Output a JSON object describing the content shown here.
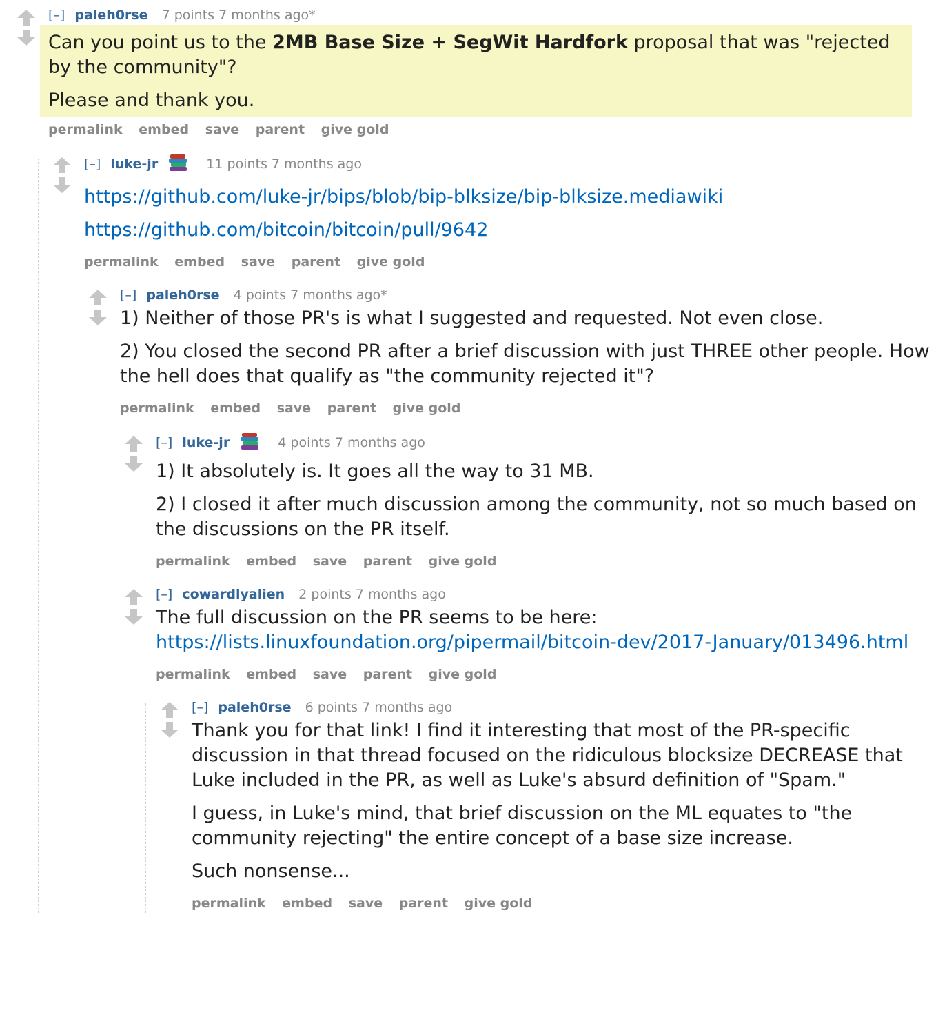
{
  "labels": {
    "expand": "[–]",
    "permalink": "permalink",
    "embed": "embed",
    "save": "save",
    "parent": "parent",
    "give_gold": "give gold"
  },
  "comments": [
    {
      "author": "paleh0rse",
      "score": "7 points",
      "time": "7 months ago*",
      "p1_pre": "Can you point us to the ",
      "p1_bold": "2MB Base Size + SegWit Hardfork",
      "p1_post": " proposal that was \"rejected by the community\"?",
      "p2": "Please and thank you."
    },
    {
      "author": "luke-jr",
      "score": "11 points",
      "time": "7 months ago",
      "link1": "https://github.com/luke-jr/bips/blob/bip-blksize/bip-blksize.mediawiki",
      "link2": "https://github.com/bitcoin/bitcoin/pull/9642"
    },
    {
      "author": "paleh0rse",
      "score": "4 points",
      "time": "7 months ago*",
      "p1": "1) Neither of those PR's is what I suggested and requested. Not even close.",
      "p2": "2) You closed the second PR after a brief discussion with just THREE other people. How the hell does that qualify as \"the community rejected it\"?"
    },
    {
      "author": "luke-jr",
      "score": "4 points",
      "time": "7 months ago",
      "p1": "1) It absolutely is. It goes all the way to 31 MB.",
      "p2": "2) I closed it after much discussion among the community, not so much based on the discussions on the PR itself."
    },
    {
      "author": "cowardlyalien",
      "score": "2 points",
      "time": "7 months ago",
      "p1": "The full discussion on the PR seems to be here:",
      "link": "https://lists.linuxfoundation.org/pipermail/bitcoin-dev/2017-January/013496.html"
    },
    {
      "author": "paleh0rse",
      "score": "6 points",
      "time": "7 months ago",
      "p1": "Thank you for that link! I find it interesting that most of the PR-specific discussion in that thread focused on the ridiculous blocksize DECREASE that Luke included in the PR, as well as Luke's absurd definition of \"Spam.\"",
      "p2": "I guess, in Luke's mind, that brief discussion on the ML equates to \"the community rejecting\" the entire concept of a base size increase.",
      "p3": "Such nonsense..."
    }
  ]
}
